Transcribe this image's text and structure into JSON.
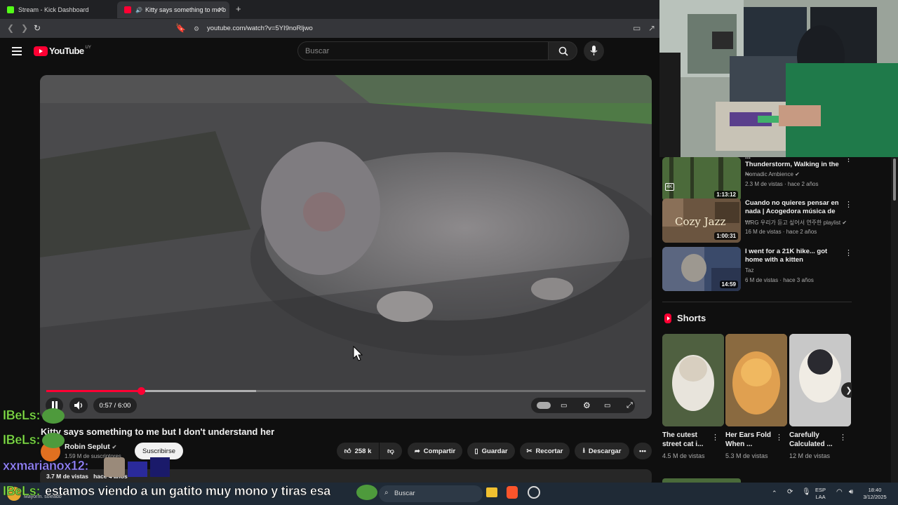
{
  "browser": {
    "tabs": [
      {
        "label": "Stream - Kick Dashboard",
        "favicon_color": "#53fc18"
      },
      {
        "label": "Kitty says something to me b",
        "favicon_color": "#ff0033"
      }
    ],
    "new_tab_label": "+",
    "url": "youtube.com/watch?v=5YI9noRljwo"
  },
  "youtube": {
    "logo_text": "YouTube",
    "logo_region": "UY",
    "search_placeholder": "Buscar"
  },
  "player": {
    "current_time": "0:57",
    "duration": "6:00",
    "time_display": "0:57 / 6:00",
    "progress": 0.158,
    "buffered": 0.35,
    "progress_color": "#ff0033"
  },
  "video": {
    "title": "Kitty says something to me but I don't understand her",
    "channel": "Robin Seplut",
    "subscribers": "1.59 M de suscriptores",
    "subscribe_label": "Suscribirse",
    "likes": "258 k",
    "share_label": "Compartir",
    "save_label": "Guardar",
    "clip_label": "Recortar",
    "download_label": "Descargar",
    "views": "3.7 M de vistas",
    "age": "hace 4 años"
  },
  "recommendations": [
    {
      "title_line1": "Thunderstorm, Walking in the ...",
      "title_line0": "...",
      "channel": "Nomadic Ambience",
      "verified": true,
      "meta": "2.3 M de vistas · hace 2 años",
      "duration": "1:13:12",
      "badge": "4K"
    },
    {
      "title": "Cuando no quieres pensar en nada | Acogedora música de ...",
      "channel": "WRG 우리가 듣고 싶어서 연주한 playlist",
      "verified": true,
      "meta": "16 M de vistas · hace 2 años",
      "duration": "1:00:31",
      "thumb_text": "Cozy Jazz"
    },
    {
      "title": "I went for a 21K hike... got home with a kitten",
      "channel": "Taz",
      "verified": false,
      "meta": "6 M de vistas · hace 3 años",
      "duration": "14:59"
    }
  ],
  "shorts": {
    "heading": "Shorts",
    "items": [
      {
        "title": "The cutest street cat i...",
        "views": "4.5 M de vistas"
      },
      {
        "title": "Her Ears Fold When ...",
        "views": "5.3 M de vistas"
      },
      {
        "title": "Carefully Calculated ...",
        "views": "12 M de vistas"
      }
    ]
  },
  "chat": [
    {
      "user": "IBeLs:",
      "message": ""
    },
    {
      "user": "IBeLs:",
      "message": ""
    },
    {
      "user": "xxmarianox12:",
      "message": ""
    },
    {
      "user": "IBeLs:",
      "message": "estamos viendo a un gatito muy mono y tiras esa"
    }
  ],
  "taskbar": {
    "weather": "Mayorm. soleado",
    "search_label": "Buscar",
    "lang_line1": "ESP",
    "lang_line2": "LAA",
    "time": "18:40",
    "date": "3/12/2025"
  }
}
